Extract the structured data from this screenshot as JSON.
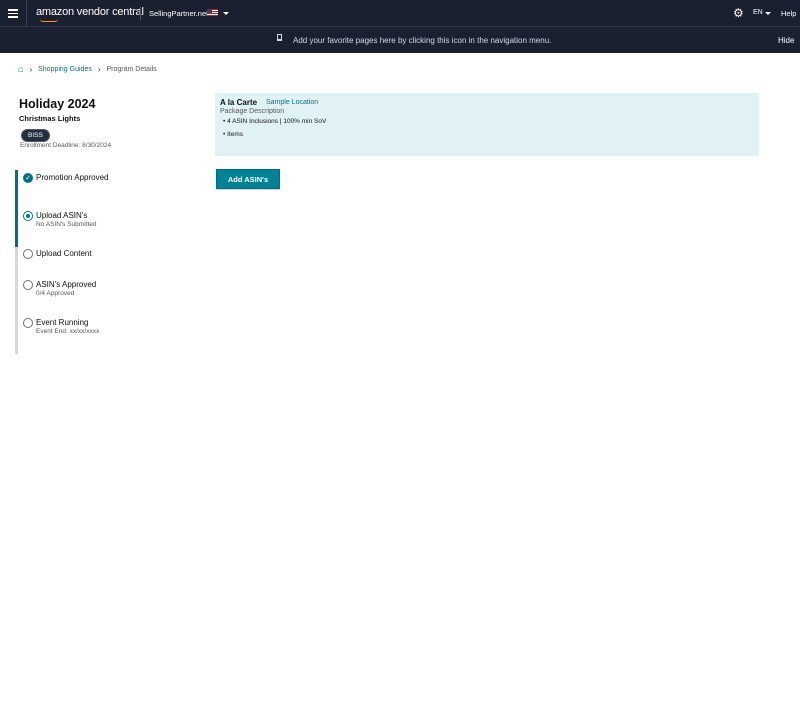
{
  "header": {
    "logo": "amazon vendor central",
    "marketplace": "SellingPartner.net",
    "language": "EN",
    "help": "Help"
  },
  "favorites": {
    "message": "Add your favorite pages here by clicking this icon in the navigation menu.",
    "hide": "Hide"
  },
  "breadcrumb": {
    "items": [
      "Shopping Guides",
      "Program Details"
    ]
  },
  "program": {
    "title": "Holiday 2024",
    "subtitle": "Christmas Lights",
    "badge": "BISS",
    "deadline": "Enrollment Deadline: 8/30/2024"
  },
  "steps": [
    {
      "label": "Promotion Approved",
      "desc": "",
      "state": "done"
    },
    {
      "label": "Upload ASIN's",
      "desc": "No ASIN's Submitted",
      "state": "current"
    },
    {
      "label": "Upload Content",
      "desc": "",
      "state": "todo"
    },
    {
      "label": "ASIN's Approved",
      "desc": "0/4 Approved",
      "state": "todo"
    },
    {
      "label": "Event Running",
      "desc": "Event End: xx/xx/xxxx",
      "state": "todo"
    }
  ],
  "package": {
    "title": "A la Carte",
    "location": "Sample Location",
    "description": "Package Description",
    "bullets": [
      "4 ASIN Inclusions | 100% min SoV",
      "Items"
    ]
  },
  "actions": {
    "add_asins": "Add ASIN's"
  },
  "colors": {
    "accent": "#007185",
    "nav": "#1a2030",
    "panel": "#e1f2f7"
  }
}
